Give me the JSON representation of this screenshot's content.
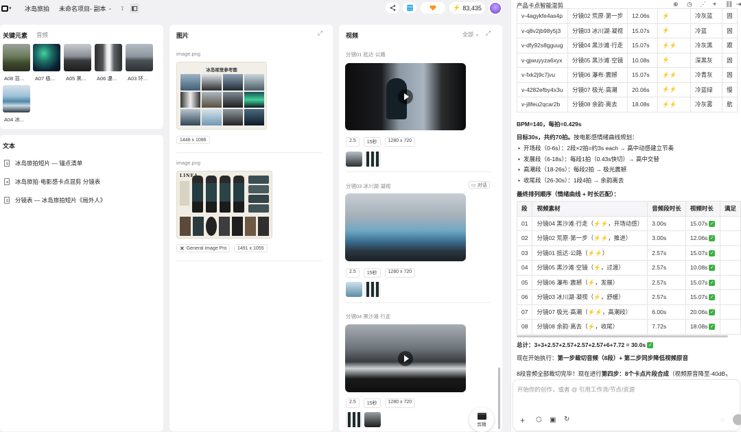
{
  "topbar": {
    "app_title": "冰岛旅拍",
    "project_name": "未命名项目- 副本",
    "credits": "83,435"
  },
  "left": {
    "tabs": [
      "关键元素",
      "音频"
    ],
    "elements": [
      {
        "label": "A08 苔..."
      },
      {
        "label": "A07 极..."
      },
      {
        "label": "A05 黑..."
      },
      {
        "label": "A06 瀑..."
      },
      {
        "label": "A03 环..."
      },
      {
        "label": "A04 冰..."
      }
    ],
    "text_title": "文本",
    "docs": [
      "冰岛旅拍短片 — 锚点清单",
      "冰岛旅拍·电影感卡点混剪 分镜表",
      "分镜表 — 冰岛旅拍短片《局外人》"
    ]
  },
  "images": {
    "title": "图片",
    "items": [
      {
        "filename": "image.png",
        "board_title": "冰岛视觉参考图",
        "size": "1448 x 1086"
      },
      {
        "filename": "image.png",
        "board_title": "LINEA",
        "model": "General image Pro",
        "size": "1491 x 1055"
      }
    ]
  },
  "videos": {
    "title": "视频",
    "filter": "全部",
    "items": [
      {
        "label": "分镜01 抵达·公路",
        "meta": [
          "2.5",
          "15秒",
          "1280 x 720"
        ]
      },
      {
        "label": "分镜03 冰川湖·凝视",
        "badge": "对话",
        "meta": [
          "2.5",
          "15秒",
          "1280 x 720"
        ]
      },
      {
        "label": "分镜04 黑沙滩·行走",
        "meta": [
          "2.5",
          "15秒",
          "1280 x 720"
        ]
      }
    ],
    "edit_label": "剪辑"
  },
  "chat": {
    "title": "产品卡点智能混剪",
    "table1": [
      [
        "v-4agykfe4as4p",
        "分镜02 荒原·第一步",
        "12.06s",
        "⚡",
        "冷灰蓝",
        "固"
      ],
      [
        "v-q8v2jb98y5j3",
        "分镜03 冰川湖·凝视",
        "15.07s",
        "⚡",
        "冷蓝",
        "固"
      ],
      [
        "v-dfy92s8gguug",
        "分镜04 黑沙滩·行走",
        "15.07s",
        "⚡⚡",
        "冷灰黑",
        "跟"
      ],
      [
        "v-gjwuyyza6xyx",
        "分镜05 黑沙滩·空镜",
        "10.08s",
        "⚡",
        "深黑灰",
        "固"
      ],
      [
        "v-fxk2j9c7jvu",
        "分镜06 瀑布·震撼",
        "15.07s",
        "⚡⚡",
        "冷青灰",
        "固"
      ],
      [
        "v-4282efby4x3u",
        "分镜07 极光·高潮",
        "20.06s",
        "⚡⚡",
        "冷蓝绿",
        "慢"
      ],
      [
        "v-j8feu2qcar2b",
        "分镜08 余韵·离去",
        "18.08s",
        "⚡⚡",
        "冷灰雾",
        "航"
      ]
    ],
    "bpm": "BPM=140，每拍=0.429s",
    "target_bold": "目标30s，共约70拍。",
    "target_rest": "按电影感情绪曲线规划：",
    "plan": [
      "开场段（0-6s）：2段×2拍=约3s each → 高中动感建立节奏",
      "发展段（6-18s）：每段1拍（0.43s快切）→ 高中交替",
      "高潮段（18-26s）：每段2拍 → 极光震撼",
      "收尾段（26-30s）：1段4拍 → 余韵离去"
    ],
    "order_title": "最终排列顺序（情绪曲线 + 时长匹配）：",
    "table2_headers": [
      "段",
      "视频素材",
      "音频段时长",
      "视频时长",
      "满足"
    ],
    "table2": [
      [
        "01",
        "分镜04 黑沙滩·行走（⚡⚡，开场动感）",
        "3.00s",
        "15.07s"
      ],
      [
        "02",
        "分镜02 荒原·第一步（⚡⚡，推进）",
        "3.00s",
        "12.06s"
      ],
      [
        "03",
        "分镜01 抵达·公路（⚡⚡）",
        "2.57s",
        "15.07s"
      ],
      [
        "04",
        "分镜05 黑沙滩·空镜（⚡，过渡）",
        "2.57s",
        "10.08s"
      ],
      [
        "05",
        "分镜06 瀑布·震撼（⚡，发展）",
        "2.57s",
        "15.07s"
      ],
      [
        "06",
        "分镜03 冰川湖·凝视（⚡，舒缓）",
        "2.57s",
        "15.07s"
      ],
      [
        "07",
        "分镜07 极光·高潮（⚡⚡，高潮段）",
        "6.00s",
        "20.06s"
      ],
      [
        "08",
        "分镜08 余韵·离去（⚡，收尾）",
        "7.72s",
        "18.08s"
      ]
    ],
    "total": "总计：3+3+2.57+2.57+2.57+2.57+6+7.72 = 30.0s",
    "exec_prefix": "现在开始执行：",
    "exec_bold": "第一步裁切音频（8段）+ 第二步同步降低视频原音",
    "done_prefix": "8段音频全部裁切完毕！现在进行",
    "done_bold": "第四步：8个卡点片段合成",
    "done_rest": "（视频原音降至-40dB，",
    "input_placeholder": "开始你的创作，或者 @ 引用工作流/节点/资源"
  }
}
